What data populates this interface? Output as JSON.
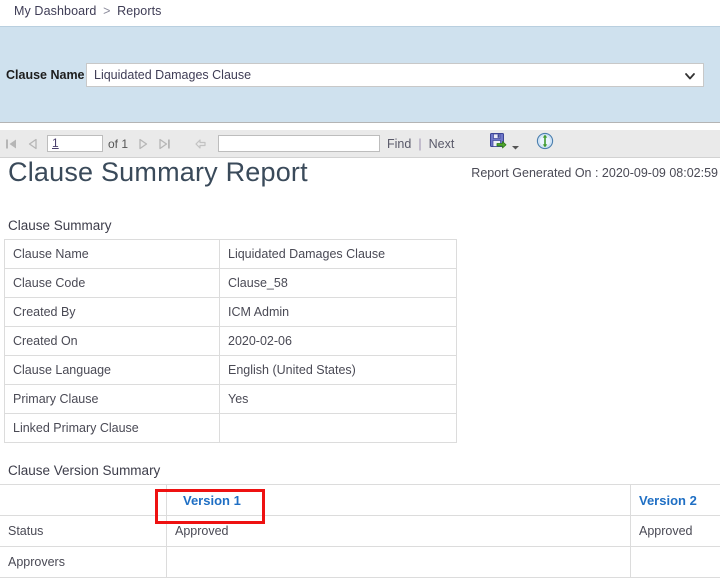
{
  "breadcrumb": {
    "items": [
      "My Dashboard",
      "Reports"
    ],
    "separator": ">"
  },
  "parameters": {
    "clause_name_label": "Clause Name",
    "clause_name_value": "Liquidated Damages Clause",
    "dropdown_icon": "chevron-down-icon"
  },
  "toolbar": {
    "first_page_icon": "first-page-icon",
    "prev_page_icon": "previous-page-icon",
    "page_number": "1",
    "of_label": "of 1",
    "next_page_icon": "next-page-icon",
    "last_page_icon": "last-page-icon",
    "back_icon": "back-to-parent-icon",
    "find_value": "",
    "find_label": "Find",
    "pipe": "|",
    "next_label": "Next",
    "export_icon": "export-save-icon",
    "export_chevron_icon": "chevron-down-icon",
    "refresh_icon": "refresh-icon"
  },
  "report": {
    "title": "Clause Summary Report",
    "generated_on": "Report Generated On : 2020-09-09 08:02:59",
    "summary_section_title": "Clause Summary",
    "summary_rows": [
      {
        "key": "Clause Name",
        "value": "Liquidated Damages Clause"
      },
      {
        "key": "Clause Code",
        "value": "Clause_58"
      },
      {
        "key": "Created By",
        "value": "ICM Admin"
      },
      {
        "key": "Created On",
        "value": "2020-02-06"
      },
      {
        "key": "Clause Language",
        "value": "English (United States)"
      },
      {
        "key": "Primary Clause",
        "value": "Yes"
      },
      {
        "key": "Linked Primary Clause",
        "value": ""
      }
    ],
    "version_section_title": "Clause Version Summary",
    "version_header": {
      "blank": "",
      "version_1": "Version 1",
      "version_2": "Version 2"
    },
    "version_rows": [
      {
        "key": "Status",
        "v1": "Approved",
        "v2": "Approved"
      },
      {
        "key": "Approvers",
        "v1": "",
        "v2": ""
      }
    ]
  },
  "annotation": {
    "name": "version-1-highlight",
    "color": "#ee1111"
  }
}
